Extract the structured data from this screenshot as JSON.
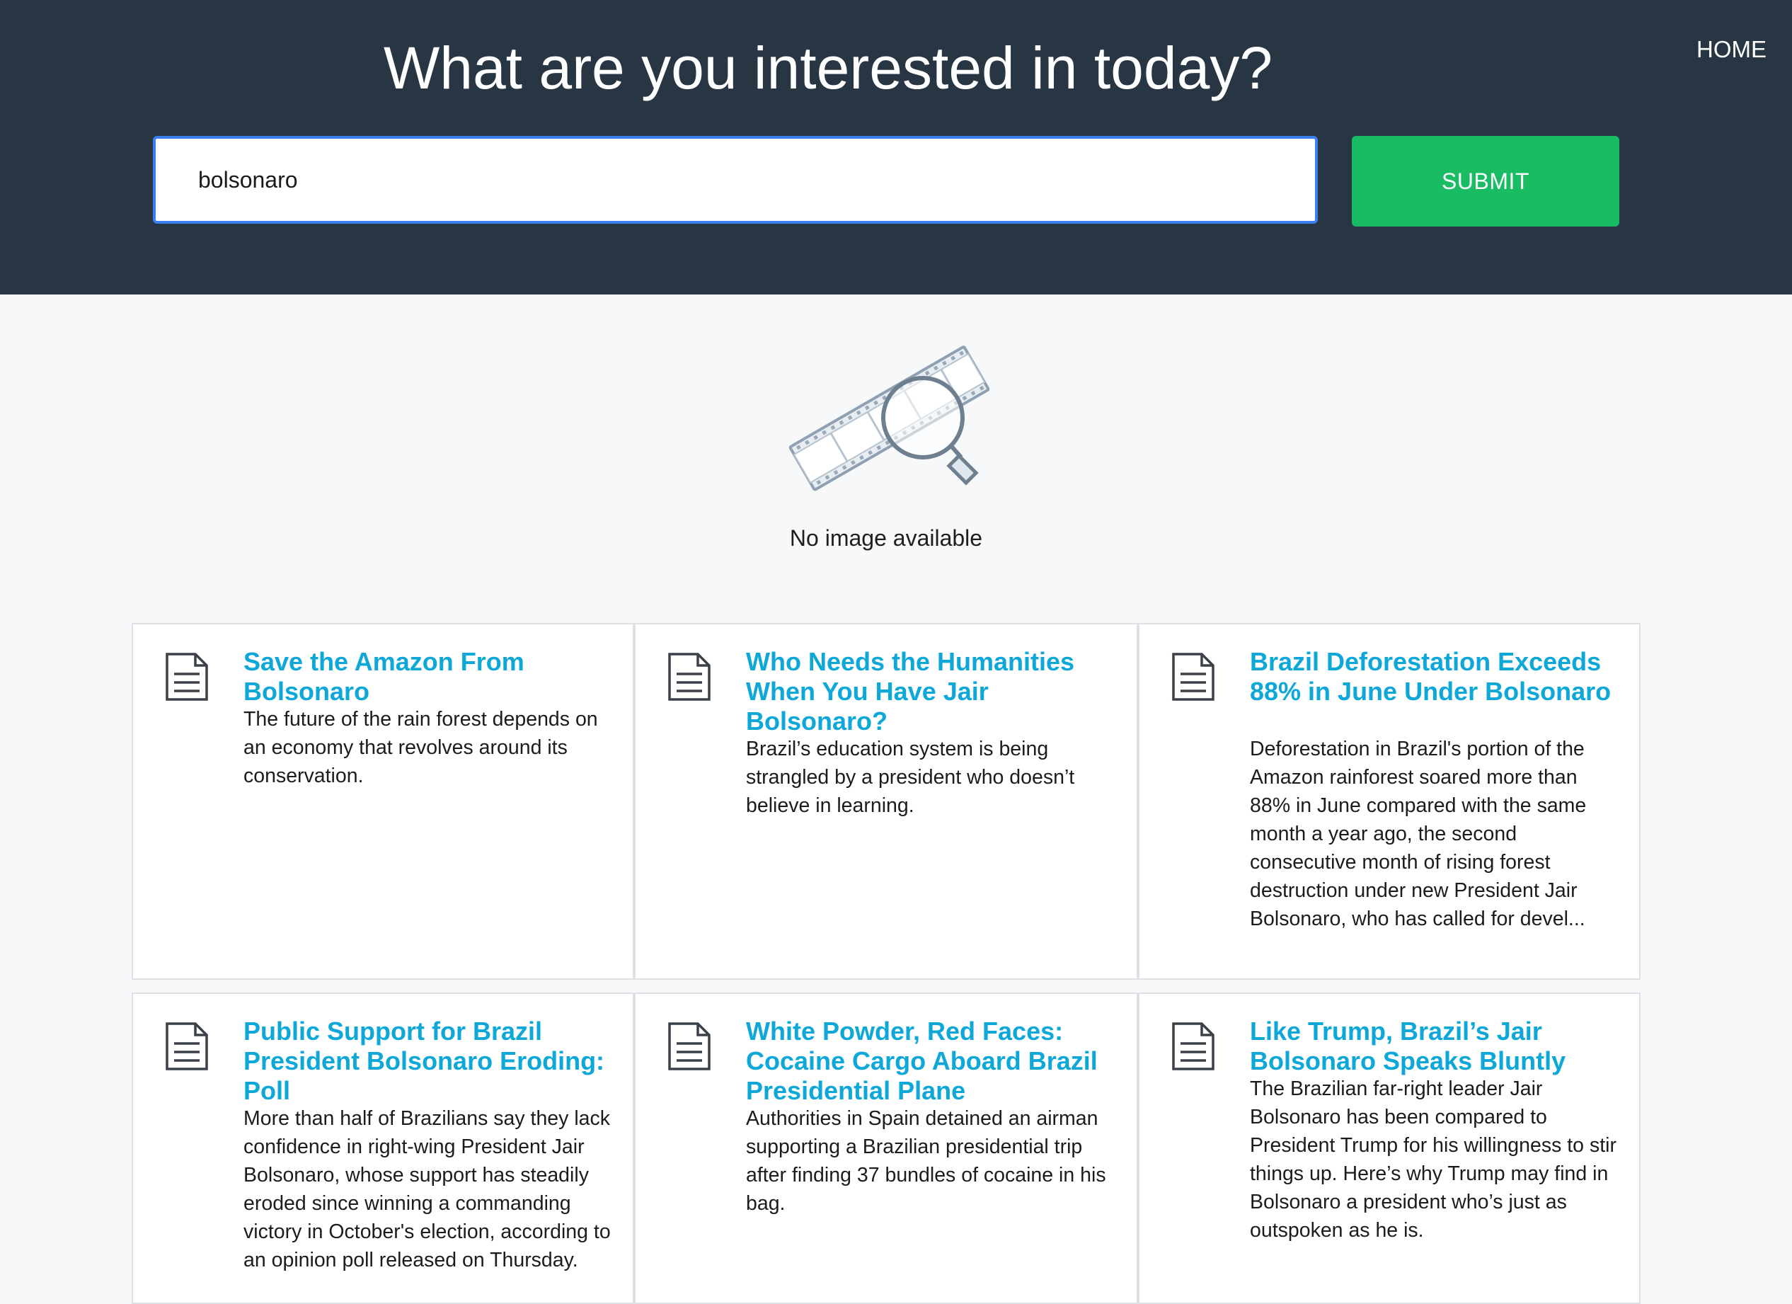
{
  "header": {
    "title": "What are you interested in today?",
    "home_label": "HOME"
  },
  "search": {
    "value": "bolsonaro",
    "submit_label": "SUBMIT"
  },
  "placeholder_image": {
    "caption": "No image available",
    "icon": "film-strip-magnifier-icon"
  },
  "results": [
    {
      "title": "Save the Amazon From Bolsonaro",
      "summary": "The future of the rain forest depends on an economy that revolves around its conservation.",
      "icon": "document-icon"
    },
    {
      "title": "Who Needs the Humanities When You Have Jair Bolsonaro?",
      "summary": "Brazil’s education system is being strangled by a president who doesn’t believe in learning.",
      "icon": "document-icon"
    },
    {
      "title": "Brazil Deforestation Exceeds 88% in June Under Bolsonaro",
      "summary": "Deforestation in Brazil's portion of the Amazon rainforest soared more than 88% in June compared with the same month a year ago, the second consecutive month of rising forest destruction under new President Jair Bolsonaro, who has called for devel...",
      "icon": "document-icon"
    },
    {
      "title": "Public Support for Brazil President Bolsonaro Eroding: Poll",
      "summary": "More than half of Brazilians say they lack confidence in right-wing President Jair Bolsonaro, whose support has steadily eroded since winning a commanding victory in October's election, according to an opinion poll released on Thursday.",
      "icon": "document-icon"
    },
    {
      "title": "White Powder, Red Faces: Cocaine Cargo Aboard Brazil Presidential Plane",
      "summary": "Authorities in Spain detained an airman supporting a Brazilian presidential trip after finding 37 bundles of cocaine in his bag.",
      "icon": "document-icon"
    },
    {
      "title": "Like Trump, Brazil’s Jair Bolsonaro Speaks Bluntly",
      "summary": "The Brazilian far-right leader Jair Bolsonaro has been compared to President Trump for his willingness to stir things up. Here’s why Trump may find in Bolsonaro a president who’s just as outspoken as he is.",
      "icon": "document-icon"
    }
  ],
  "colors": {
    "header_bg": "#283543",
    "submit_bg": "#19bb63",
    "title_link": "#0da7d8",
    "focus_border": "#3d7ff0"
  }
}
